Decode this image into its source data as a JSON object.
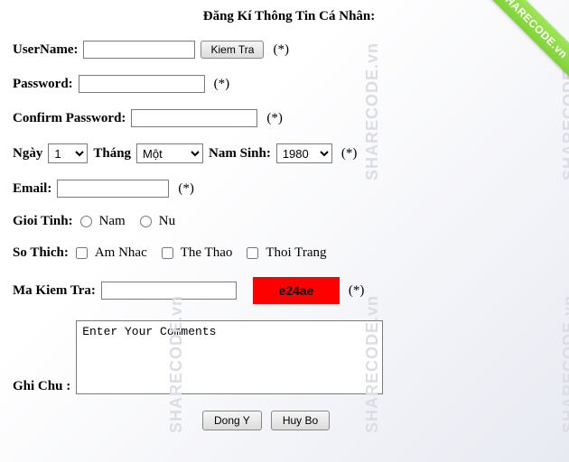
{
  "watermark_text": "SHARECODE.vn",
  "ribbon_text": "SHARECODE.vn",
  "title": "Đăng Kí Thông Tin Cá Nhân:",
  "required_marker": "(*)",
  "username": {
    "label": "UserName:",
    "value": "",
    "check_btn": "Kiem Tra"
  },
  "password": {
    "label": "Password:",
    "value": ""
  },
  "confirm": {
    "label": "Confirm Password:",
    "value": ""
  },
  "dob": {
    "day_label": "Ngày",
    "day_value": "1",
    "month_label": "Tháng",
    "month_value": "Một",
    "year_label": "Nam Sinh:",
    "year_value": "1980"
  },
  "email": {
    "label": "Email:",
    "value": ""
  },
  "gender": {
    "label": "Gioi Tinh:",
    "opt_male": "Nam",
    "opt_female": "Nu"
  },
  "hobbies": {
    "label": "So Thich:",
    "opt_music": "Am Nhac",
    "opt_sport": "The Thao",
    "opt_fashion": "Thoi Trang"
  },
  "captcha": {
    "label": "Ma Kiem Tra:",
    "value": "",
    "code": "e24ae"
  },
  "comments": {
    "label": "Ghi Chu :",
    "placeholder": "Enter Your Comments"
  },
  "buttons": {
    "ok": "Dong Y",
    "cancel": "Huy Bo"
  }
}
